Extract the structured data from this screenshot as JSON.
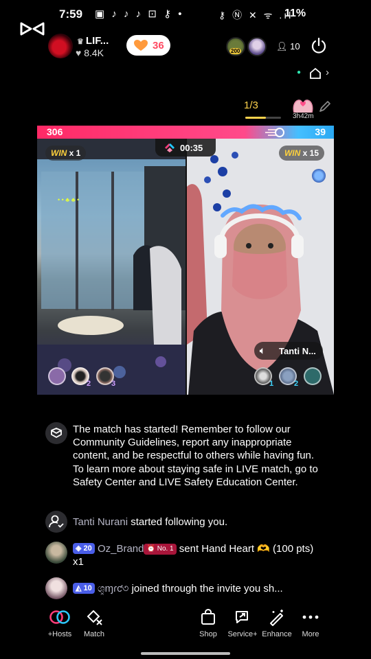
{
  "status": {
    "time": "7:59",
    "left_icons": "▣ ♪ ♪ ♪ ⊡ ⚷ •",
    "right_icons": "⚷ Ⓝ ✕ ᯤ .ıl",
    "battery": "11%"
  },
  "host": {
    "name": "LIF...",
    "likes": "8.4K",
    "heart_count": "36"
  },
  "viewers": {
    "count": "10",
    "first_badge": "200"
  },
  "match": {
    "page": "1/3",
    "small_timer": "3h42m",
    "score_left": "306",
    "score_right": "39",
    "timer": "00:35",
    "win_left_label": "WIN",
    "win_left_count": "x 1",
    "win_right_label": "WIN",
    "win_right_count": "x 15",
    "opponent_name": "Tanti N...",
    "left_ranks": [
      "",
      "2",
      "3"
    ],
    "right_ranks": [
      "1",
      "2",
      ""
    ]
  },
  "chat": {
    "system_message": "The match has started! Remember to follow our Community Guidelines, report any inappropriate content, and be respectful to others while having fun. To learn more about staying safe in LIVE match, go to Safety Center and LIVE Safety Education Center.",
    "follow_name": "Tanti Nurani",
    "follow_text": " started following you.",
    "gift_level": "20",
    "gift_user": "Oz_Brand",
    "gift_badge": "No. 1",
    "gift_text": " sent Hand Heart 🫶  (100 pts) x1",
    "join_level": "10",
    "join_user": "ශ͓ɱɾƈ৩",
    "join_text": " joined through the invite you sh..."
  },
  "toolbar": {
    "hosts": "+Hosts",
    "match": "Match",
    "shop": "Shop",
    "service": "Service+",
    "enhance": "Enhance",
    "more": "More"
  },
  "colors": {
    "left_team": "#ff2a66",
    "right_team": "#2aa8f2",
    "win_gold": "#ffd23c",
    "level_badge": "#4a5ee8"
  }
}
